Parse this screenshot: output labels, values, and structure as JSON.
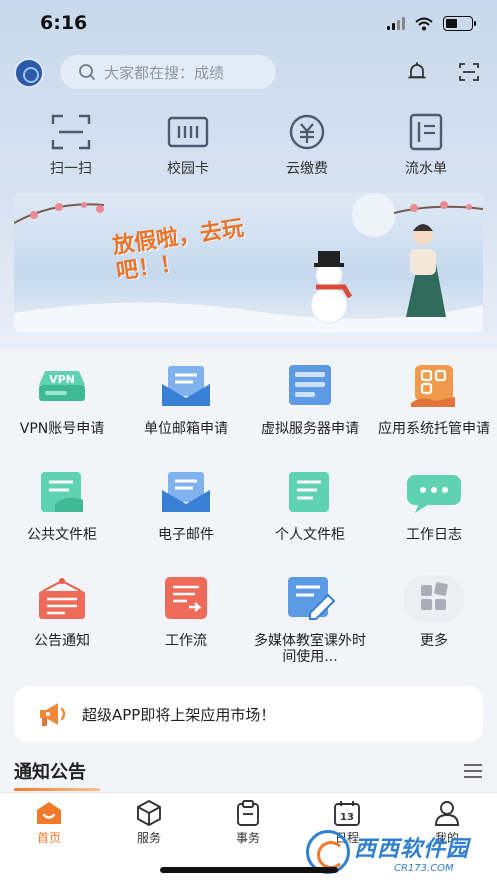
{
  "status_bar": {
    "time": "6:16",
    "battery_level": 0.45
  },
  "header": {
    "search_placeholder": "大家都在搜：成绩"
  },
  "quick_actions": [
    {
      "label": "扫一扫",
      "icon": "scan-icon"
    },
    {
      "label": "校园卡",
      "icon": "card-icon"
    },
    {
      "label": "云缴费",
      "icon": "payment-icon"
    },
    {
      "label": "流水单",
      "icon": "statement-icon"
    }
  ],
  "banner": {
    "text": "放假啦，去玩吧！！"
  },
  "apps": [
    {
      "label": "VPN账号申请",
      "icon": "vpn-icon",
      "color": "#4cc4a3",
      "badge": "VPN"
    },
    {
      "label": "单位邮箱申请",
      "icon": "mailbox-icon",
      "color": "#4a8fe0"
    },
    {
      "label": "虚拟服务器申请",
      "icon": "server-icon",
      "color": "#4a8fe0"
    },
    {
      "label": "应用系统托管申请",
      "icon": "app-hosting-icon",
      "color": "#f08a3a"
    },
    {
      "label": "公共文件柜",
      "icon": "public-folder-icon",
      "color": "#4cc4a3"
    },
    {
      "label": "电子邮件",
      "icon": "email-icon",
      "color": "#4a8fe0"
    },
    {
      "label": "个人文件柜",
      "icon": "personal-folder-icon",
      "color": "#4cc4a3"
    },
    {
      "label": "工作日志",
      "icon": "work-log-icon",
      "color": "#4cc4a3"
    },
    {
      "label": "公告通知",
      "icon": "announcement-icon",
      "color": "#ec5a4a"
    },
    {
      "label": "工作流",
      "icon": "workflow-icon",
      "color": "#ec5a4a"
    },
    {
      "label": "多媒体教室课外时间使用...",
      "icon": "multimedia-icon",
      "color": "#4a8fe0"
    },
    {
      "label": "更多",
      "icon": "more-icon",
      "color": "#c7cbd2"
    }
  ],
  "notice": {
    "text": "超级APP即将上架应用市场！"
  },
  "section": {
    "title": "通知公告"
  },
  "tabs": [
    {
      "label": "首页",
      "icon": "home-icon",
      "active": true
    },
    {
      "label": "服务",
      "icon": "service-icon",
      "active": false
    },
    {
      "label": "事务",
      "icon": "affairs-icon",
      "active": false
    },
    {
      "label": "日程",
      "icon": "calendar-icon",
      "active": false,
      "date": "13"
    },
    {
      "label": "我的",
      "icon": "profile-icon",
      "active": false
    }
  ],
  "watermark": {
    "name": "西西软件园",
    "url": "CR173.COM"
  },
  "colors": {
    "accent": "#f07a2a",
    "blue": "#4a8fe0",
    "green": "#4cc4a3",
    "red": "#ec5a4a"
  }
}
